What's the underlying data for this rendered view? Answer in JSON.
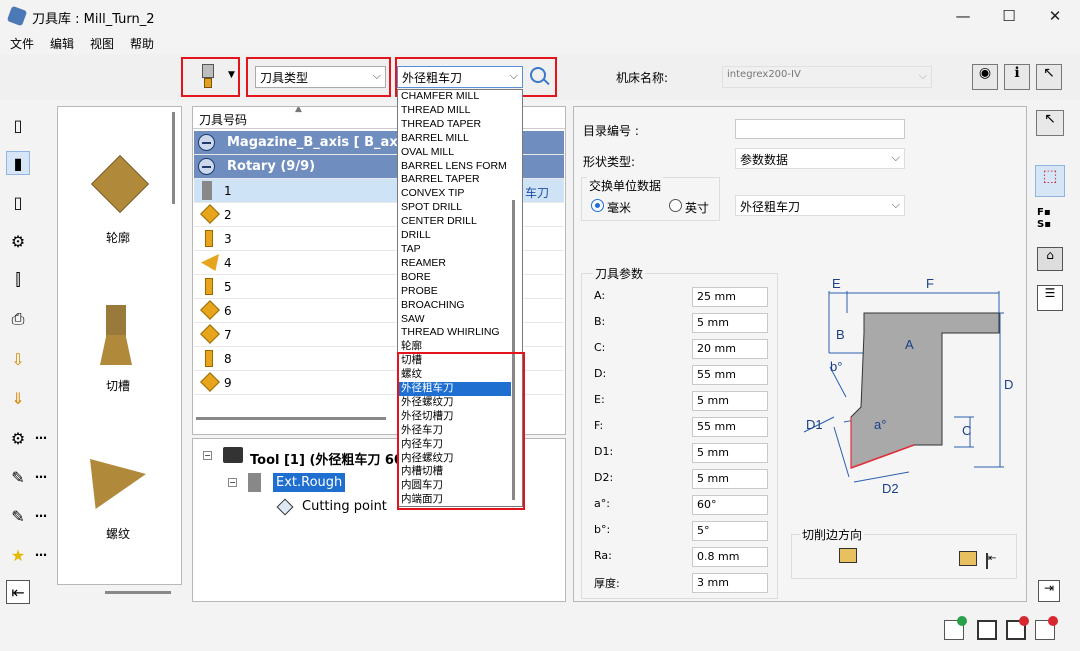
{
  "window": {
    "title": "刀具库 : Mill_Turn_2",
    "minimize": "—",
    "maximize": "☐",
    "close": "✕"
  },
  "menu": [
    "文件",
    "编辑",
    "视图",
    "帮助"
  ],
  "toolbar": {
    "tool_type_combo": "刀具类型",
    "tool_kind_combo": "外径粗车刀",
    "machine_label": "机床名称:",
    "machine_value": "integrex200-IV"
  },
  "gallery": {
    "items": [
      "轮廓",
      "切槽",
      "螺纹"
    ]
  },
  "tool_list": {
    "header": "刀具号码",
    "groups": [
      "Magazine_B_axis [ B_ax...",
      "Rotary (9/9)"
    ],
    "rows": [
      "1",
      "2",
      "3",
      "4",
      "5",
      "6",
      "7",
      "8",
      "9"
    ],
    "row1_extra": "车刀"
  },
  "dropdown": {
    "items": [
      "CHAMFER MILL",
      "THREAD MILL",
      "THREAD TAPER",
      "BARREL MILL",
      "OVAL MILL",
      "BARREL LENS FORM",
      "BARREL TAPER",
      "CONVEX TIP",
      "SPOT DRILL",
      "CENTER DRILL",
      "DRILL",
      "TAP",
      "REAMER",
      "BORE",
      "PROBE",
      "BROACHING",
      "SAW",
      "THREAD WHIRLING",
      "轮廓",
      "切槽",
      "螺纹",
      "外径粗车刀",
      "外径螺纹刀",
      "外径切槽刀",
      "外径车刀",
      "内径车刀",
      "内径螺纹刀",
      "内槽切槽",
      "内圆车刀",
      "内端面刀"
    ],
    "selected_index": 21
  },
  "tree": {
    "root": "Tool [1] (外径粗车刀 60°",
    "child": "Ext.Rough",
    "grandchild": "Cutting point"
  },
  "props": {
    "catalog_label": "目录编号 :",
    "catalog_value": "",
    "shape_label": "形状类型:",
    "shape_value": "参数数据",
    "unit_group": "交换单位数据",
    "unit_mm": "毫米",
    "unit_inch": "英寸",
    "unit_combo": "外径粗车刀",
    "params_title": "刀具参数",
    "params": [
      {
        "label": "A:",
        "value": "25 mm"
      },
      {
        "label": "B:",
        "value": "5 mm"
      },
      {
        "label": "C:",
        "value": "20 mm"
      },
      {
        "label": "D:",
        "value": "55 mm"
      },
      {
        "label": "E:",
        "value": "5 mm"
      },
      {
        "label": "F:",
        "value": "55 mm"
      },
      {
        "label": "D1:",
        "value": "5 mm"
      },
      {
        "label": "D2:",
        "value": "5 mm"
      },
      {
        "label": "a°:",
        "value": "60°"
      },
      {
        "label": "b°:",
        "value": "5°"
      },
      {
        "label": "Ra:",
        "value": "0.8 mm"
      },
      {
        "label": "厚度:",
        "value": "3 mm"
      }
    ],
    "cut_dir_label": "切削边方向"
  },
  "diagram": {
    "E": "E",
    "F": "F",
    "B": "B",
    "A": "A",
    "b": "b°",
    "D": "D",
    "D1": "D1",
    "a": "a°",
    "C": "C",
    "D2": "D2"
  }
}
